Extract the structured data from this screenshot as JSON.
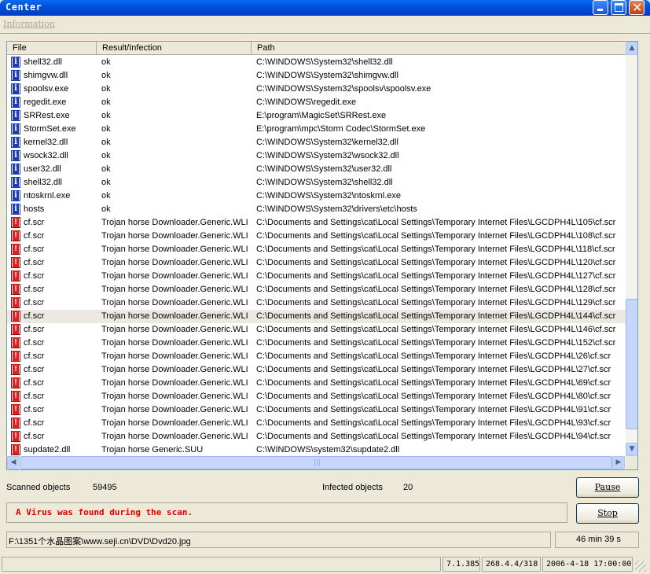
{
  "window": {
    "title": "Center"
  },
  "menu": {
    "information": "Information"
  },
  "columns": {
    "file": "File",
    "result": "Result/Infection",
    "path": "Path"
  },
  "rows": [
    {
      "icon": "info-icon",
      "file": "shell32.dll",
      "result": "ok",
      "path": "C:\\WINDOWS\\System32\\shell32.dll"
    },
    {
      "icon": "info-icon",
      "file": "shimgvw.dll",
      "result": "ok",
      "path": "C:\\WINDOWS\\System32\\shimgvw.dll"
    },
    {
      "icon": "info-icon",
      "file": "spoolsv.exe",
      "result": "ok",
      "path": "C:\\WINDOWS\\System32\\spoolsv\\spoolsv.exe"
    },
    {
      "icon": "info-icon",
      "file": "regedit.exe",
      "result": "ok",
      "path": "C:\\WINDOWS\\regedit.exe"
    },
    {
      "icon": "info-icon",
      "file": "SRRest.exe",
      "result": "ok",
      "path": "E:\\program\\MagicSet\\SRRest.exe"
    },
    {
      "icon": "info-icon",
      "file": "StormSet.exe",
      "result": "ok",
      "path": "E:\\program\\mpc\\Storm Codec\\StormSet.exe"
    },
    {
      "icon": "info-icon",
      "file": "kernel32.dll",
      "result": "ok",
      "path": "C:\\WINDOWS\\System32\\kernel32.dll"
    },
    {
      "icon": "info-icon",
      "file": "wsock32.dll",
      "result": "ok",
      "path": "C:\\WINDOWS\\System32\\wsock32.dll"
    },
    {
      "icon": "info-icon",
      "file": "user32.dll",
      "result": "ok",
      "path": "C:\\WINDOWS\\System32\\user32.dll"
    },
    {
      "icon": "info-icon",
      "file": "shell32.dll",
      "result": "ok",
      "path": "C:\\WINDOWS\\System32\\shell32.dll"
    },
    {
      "icon": "info-icon",
      "file": "ntoskrnl.exe",
      "result": "ok",
      "path": "C:\\WINDOWS\\System32\\ntoskrnl.exe"
    },
    {
      "icon": "info-icon",
      "file": "hosts",
      "result": "ok",
      "path": "C:\\WINDOWS\\System32\\drivers\\etc\\hosts"
    },
    {
      "icon": "warning-icon",
      "file": "cf.scr",
      "result": "Trojan horse Downloader.Generic.WLI",
      "path": "C:\\Documents and Settings\\cat\\Local Settings\\Temporary Internet Files\\LGCDPH4L\\105\\cf.scr"
    },
    {
      "icon": "warning-icon",
      "file": "cf.scr",
      "result": "Trojan horse Downloader.Generic.WLI",
      "path": "C:\\Documents and Settings\\cat\\Local Settings\\Temporary Internet Files\\LGCDPH4L\\108\\cf.scr"
    },
    {
      "icon": "warning-icon",
      "file": "cf.scr",
      "result": "Trojan horse Downloader.Generic.WLI",
      "path": "C:\\Documents and Settings\\cat\\Local Settings\\Temporary Internet Files\\LGCDPH4L\\118\\cf.scr"
    },
    {
      "icon": "warning-icon",
      "file": "cf.scr",
      "result": "Trojan horse Downloader.Generic.WLI",
      "path": "C:\\Documents and Settings\\cat\\Local Settings\\Temporary Internet Files\\LGCDPH4L\\120\\cf.scr"
    },
    {
      "icon": "warning-icon",
      "file": "cf.scr",
      "result": "Trojan horse Downloader.Generic.WLI",
      "path": "C:\\Documents and Settings\\cat\\Local Settings\\Temporary Internet Files\\LGCDPH4L\\127\\cf.scr"
    },
    {
      "icon": "warning-icon",
      "file": "cf.scr",
      "result": "Trojan horse Downloader.Generic.WLI",
      "path": "C:\\Documents and Settings\\cat\\Local Settings\\Temporary Internet Files\\LGCDPH4L\\128\\cf.scr"
    },
    {
      "icon": "warning-icon",
      "file": "cf.scr",
      "result": "Trojan horse Downloader.Generic.WLI",
      "path": "C:\\Documents and Settings\\cat\\Local Settings\\Temporary Internet Files\\LGCDPH4L\\129\\cf.scr"
    },
    {
      "icon": "warning-icon",
      "file": "cf.scr",
      "result": "Trojan horse Downloader.Generic.WLI",
      "path": "C:\\Documents and Settings\\cat\\Local Settings\\Temporary Internet Files\\LGCDPH4L\\144\\cf.scr",
      "selected": true
    },
    {
      "icon": "warning-icon",
      "file": "cf.scr",
      "result": "Trojan horse Downloader.Generic.WLI",
      "path": "C:\\Documents and Settings\\cat\\Local Settings\\Temporary Internet Files\\LGCDPH4L\\146\\cf.scr"
    },
    {
      "icon": "warning-icon",
      "file": "cf.scr",
      "result": "Trojan horse Downloader.Generic.WLI",
      "path": "C:\\Documents and Settings\\cat\\Local Settings\\Temporary Internet Files\\LGCDPH4L\\152\\cf.scr"
    },
    {
      "icon": "warning-icon",
      "file": "cf.scr",
      "result": "Trojan horse Downloader.Generic.WLI",
      "path": "C:\\Documents and Settings\\cat\\Local Settings\\Temporary Internet Files\\LGCDPH4L\\26\\cf.scr"
    },
    {
      "icon": "warning-icon",
      "file": "cf.scr",
      "result": "Trojan horse Downloader.Generic.WLI",
      "path": "C:\\Documents and Settings\\cat\\Local Settings\\Temporary Internet Files\\LGCDPH4L\\27\\cf.scr"
    },
    {
      "icon": "warning-icon",
      "file": "cf.scr",
      "result": "Trojan horse Downloader.Generic.WLI",
      "path": "C:\\Documents and Settings\\cat\\Local Settings\\Temporary Internet Files\\LGCDPH4L\\69\\cf.scr"
    },
    {
      "icon": "warning-icon",
      "file": "cf.scr",
      "result": "Trojan horse Downloader.Generic.WLI",
      "path": "C:\\Documents and Settings\\cat\\Local Settings\\Temporary Internet Files\\LGCDPH4L\\80\\cf.scr"
    },
    {
      "icon": "warning-icon",
      "file": "cf.scr",
      "result": "Trojan horse Downloader.Generic.WLI",
      "path": "C:\\Documents and Settings\\cat\\Local Settings\\Temporary Internet Files\\LGCDPH4L\\91\\cf.scr"
    },
    {
      "icon": "warning-icon",
      "file": "cf.scr",
      "result": "Trojan horse Downloader.Generic.WLI",
      "path": "C:\\Documents and Settings\\cat\\Local Settings\\Temporary Internet Files\\LGCDPH4L\\93\\cf.scr"
    },
    {
      "icon": "warning-icon",
      "file": "cf.scr",
      "result": "Trojan horse Downloader.Generic.WLI",
      "path": "C:\\Documents and Settings\\cat\\Local Settings\\Temporary Internet Files\\LGCDPH4L\\94\\cf.scr"
    },
    {
      "icon": "warning-icon",
      "file": "supdate2.dll",
      "result": "Trojan horse Generic.SUU",
      "path": "C:\\WINDOWS\\system32\\supdate2.dll"
    }
  ],
  "stats": {
    "scanned_label": "Scanned objects",
    "scanned_value": "59495",
    "infected_label": "Infected objects",
    "infected_value": "20"
  },
  "buttons": {
    "pause": "Pause",
    "stop": "Stop"
  },
  "message": "A Virus was found during the scan.",
  "current_file": "F:\\1351个水晶图案\\www.seji.cn\\DVD\\Dvd20.jpg",
  "elapsed": "46 min 39 s",
  "statusbar": {
    "version": "7.1.385",
    "database": "268.4.4/318",
    "datetime": "2006-4-18 17:00:00"
  },
  "colors": {
    "titlebar": "#0050de",
    "message": "#e00000",
    "selected_row": "#ebe9e1"
  }
}
